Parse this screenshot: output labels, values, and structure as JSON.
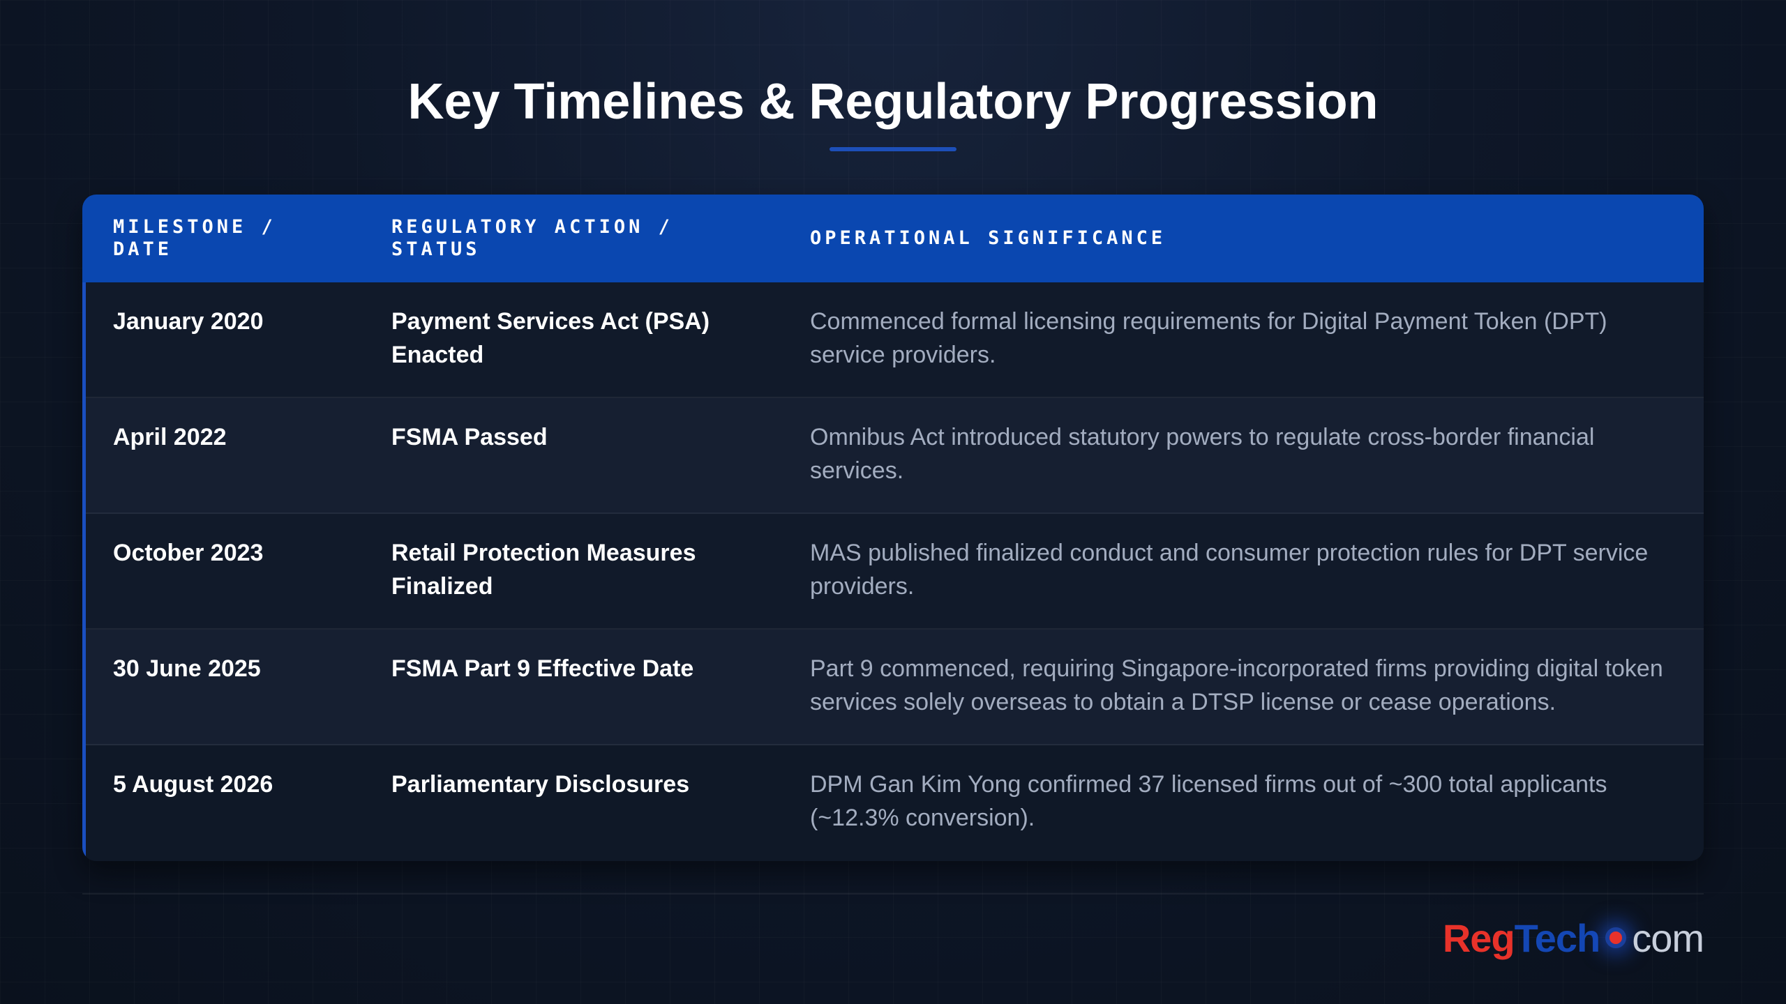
{
  "page": {
    "title": "Key Timelines & Regulatory Progression"
  },
  "table": {
    "headers": [
      "MILESTONE / DATE",
      "REGULATORY ACTION / STATUS",
      "OPERATIONAL SIGNIFICANCE"
    ],
    "rows": [
      {
        "date": "January 2020",
        "action": "Payment Services Act (PSA) Enacted",
        "significance": "Commenced formal licensing requirements for Digital Payment Token (DPT) service providers."
      },
      {
        "date": "April 2022",
        "action": "FSMA Passed",
        "significance": "Omnibus Act introduced statutory powers to regulate cross-border financial services."
      },
      {
        "date": "October 2023",
        "action": "Retail Protection Measures Finalized",
        "significance": "MAS published finalized conduct and consumer protection rules for DPT service providers."
      },
      {
        "date": "30 June 2025",
        "action": "FSMA Part 9 Effective Date",
        "significance": "Part 9 commenced, requiring Singapore-incorporated firms providing digital token services solely overseas to obtain a DTSP license or cease operations."
      },
      {
        "date": "5 August 2026",
        "action": "Parliamentary Disclosures",
        "significance": "DPM Gan Kim Yong confirmed 37 licensed firms out of ~300 total applicants (~12.3% conversion)."
      }
    ]
  },
  "logo": {
    "part_reg": "Reg",
    "part_tech": "Tech",
    "part_com": "com",
    "colors": {
      "reg": "#e8322a",
      "tech": "#1447b4",
      "com": "#c8cfdc"
    }
  },
  "theme": {
    "background": "#0b1220",
    "header_bar": "#0a47b0",
    "accent": "#1d4fb8",
    "significance_text": "#a3adc0"
  }
}
